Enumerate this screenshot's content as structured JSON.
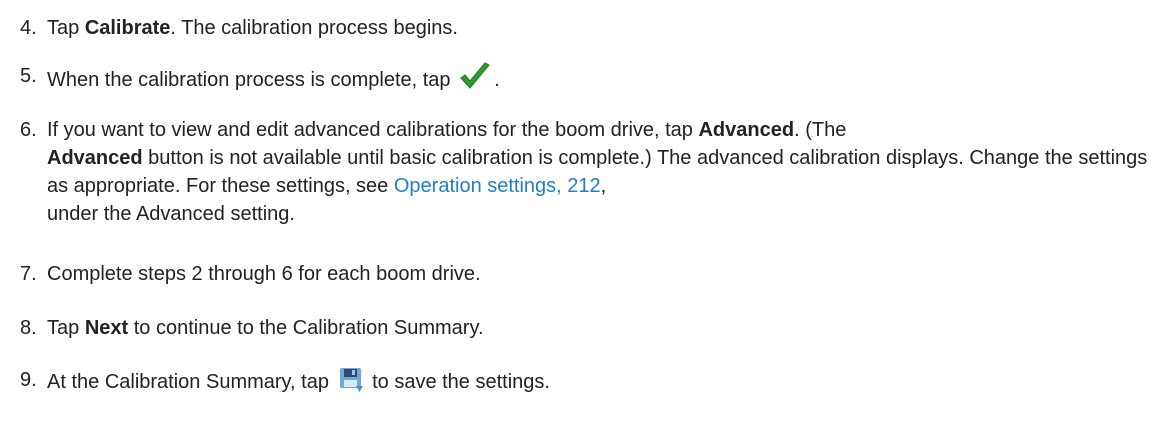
{
  "steps": [
    {
      "number": "4.",
      "pre": "Tap ",
      "bold": "Calibrate",
      "post": ". The calibration process begins."
    },
    {
      "number": "5.",
      "pre": "When the calibration process is complete, tap ",
      "icon": "checkmark-icon",
      "post": "."
    },
    {
      "number": "6.",
      "pre": "If you want to view and edit advanced calibrations for the boom drive, tap ",
      "bold1": "Advanced",
      "mid1": ". (The",
      "bold2": "Advanced",
      "mid2": " button is not available until basic calibration is complete.) The advanced calibration displays. Change the settings as appropriate. For these settings, see ",
      "link": "Operation settings, 212",
      "post": ",",
      "line4": "under the Advanced setting."
    },
    {
      "number": "7.",
      "text": "Complete steps 2 through 6 for each boom drive."
    },
    {
      "number": "8.",
      "pre": "Tap ",
      "bold": "Next",
      "post": " to continue to the Calibration Summary."
    },
    {
      "number": "9.",
      "pre": "At the Calibration Summary, tap ",
      "icon": "save-icon",
      "post": " to save the settings."
    }
  ],
  "colors": {
    "text": "#222222",
    "link": "#1f7fc4",
    "check": "#2e9b2e"
  }
}
